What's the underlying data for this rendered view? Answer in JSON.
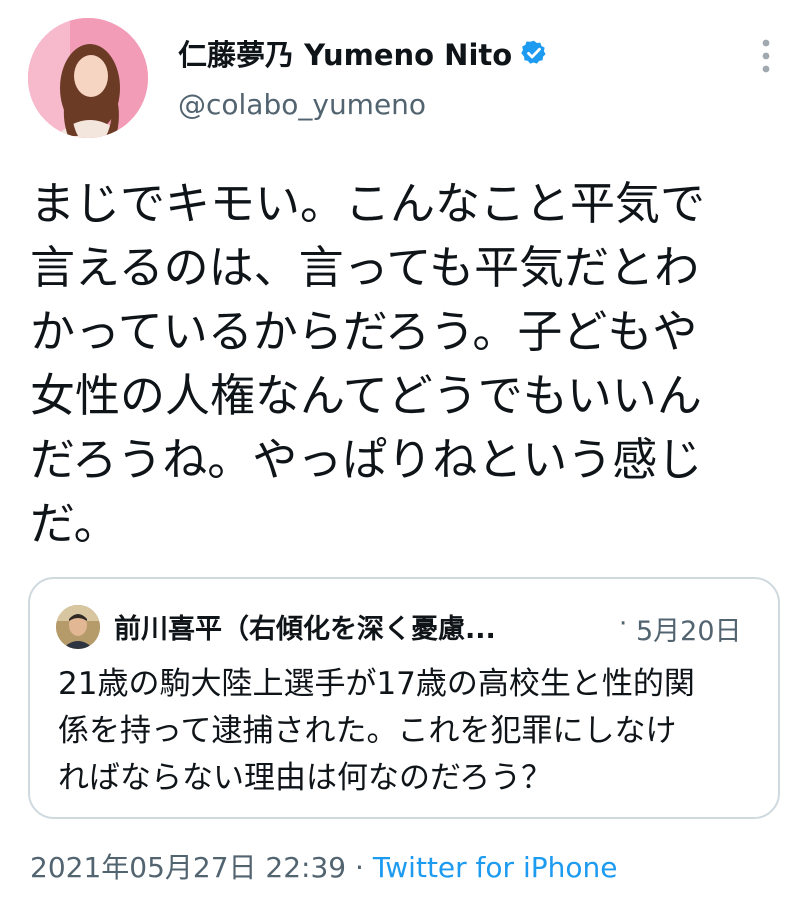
{
  "author": {
    "display_name": "仁藤夢乃 Yumeno Nito",
    "handle": "@colabo_yumeno",
    "verified_color": "#1d9bf0"
  },
  "tweet": {
    "lines": [
      "まじでキモい。こんなこと平気で",
      "言えるのは、言っても平気だとわ",
      "かっているからだろう。子どもや",
      "女性の人権なんてどうでもいいん",
      "だろうね。やっぱりねという感じ",
      "だ。"
    ]
  },
  "quoted_tweet": {
    "author_name": "前川喜平（右傾化を深く憂慮...",
    "separator": "·",
    "date": "5月20日",
    "lines": [
      "21歳の駒大陸上選手が17歳の高校生と性的関",
      "係を持って逮捕された。これを犯罪にしなけ",
      "ればならない理由は何なのだろう？"
    ]
  },
  "meta": {
    "timestamp": "2021年05月27日 22:39",
    "separator": " · ",
    "source": "Twitter for iPhone"
  },
  "icons": {
    "verified": "verified-badge-icon",
    "more": "more-vertical-icon"
  }
}
